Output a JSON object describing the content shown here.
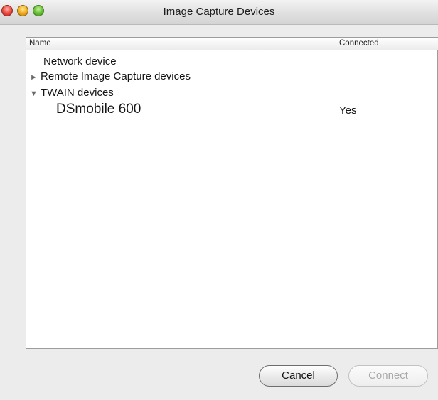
{
  "window": {
    "title": "Image Capture Devices"
  },
  "table": {
    "columns": {
      "name": "Name",
      "connected": "Connected"
    },
    "rows": [
      {
        "label": "Network device",
        "connected": ""
      },
      {
        "label": "Remote Image Capture devices",
        "connected": "",
        "disclosure": "►"
      },
      {
        "label": "TWAIN devices",
        "connected": "",
        "disclosure": "▼"
      },
      {
        "label": "DSmobile 600",
        "connected": "Yes"
      }
    ]
  },
  "buttons": {
    "cancel": "Cancel",
    "connect": "Connect"
  },
  "colors": {
    "close": "#f0544a",
    "minimize": "#f5b529",
    "zoom": "#72c73d",
    "disabled_text": "#a9a9a9"
  }
}
